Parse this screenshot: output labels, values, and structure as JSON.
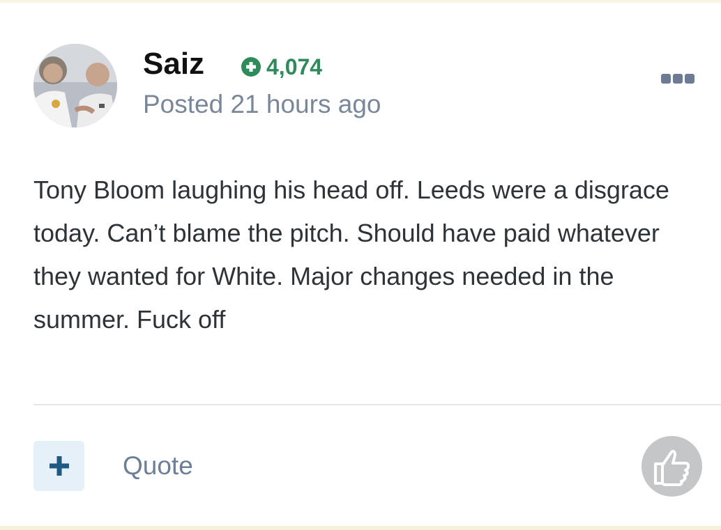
{
  "post": {
    "author": {
      "name": "Saiz",
      "reputation": "4,074",
      "avatar_icon": "user-avatar-photo"
    },
    "posted": "Posted 21 hours ago",
    "body_lines": [
      "Tony Bloom laughing his head off. Leeds were a disgrace",
      "today. Can’t blame the pitch. Should have paid whatever",
      "they wanted for White. Major changes needed in the",
      "summer. Fuck off"
    ]
  },
  "actions": {
    "quote_label": "Quote",
    "multiquote_icon": "plus-icon",
    "like_icon": "thumbs-up-icon",
    "more_icon": "ellipsis-icon"
  },
  "colors": {
    "reputation": "#2f8a5c",
    "meta_text": "#7a8798",
    "multiquote_bg": "#e6f0f9",
    "multiquote_plus": "#1f5a85",
    "like_bg": "#c4c6c8"
  }
}
